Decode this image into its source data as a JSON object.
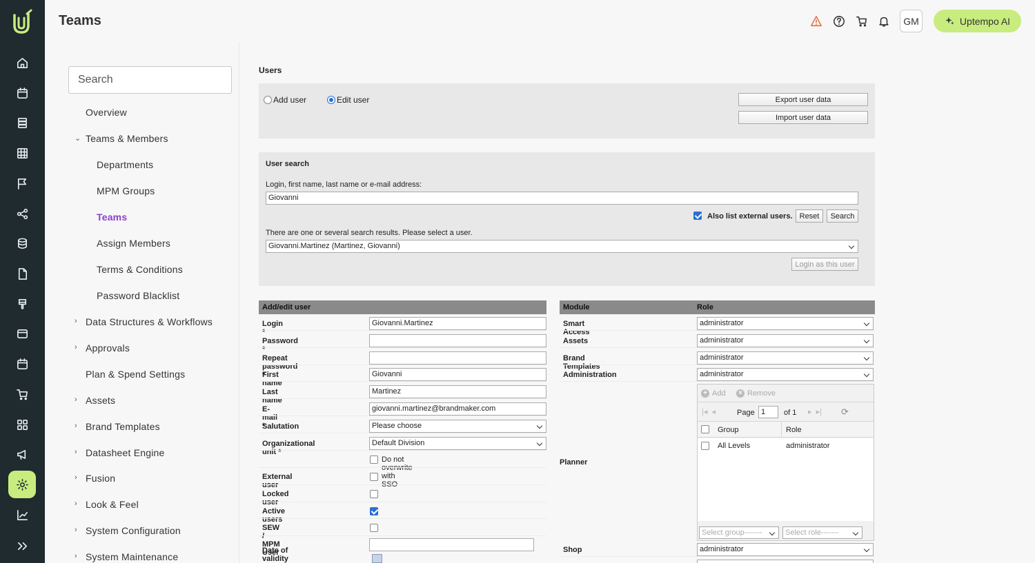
{
  "app": {
    "title": "Teams"
  },
  "header": {
    "avatar_initials": "GM",
    "ai_button_label": "Uptempo AI"
  },
  "rail_icons": [
    "home-icon",
    "calendar-icon",
    "stack-icon",
    "grid-table-icon",
    "flag-icon",
    "share-nodes-icon",
    "database-icon",
    "document-icon",
    "brush-icon",
    "window-icon",
    "calendar-icon",
    "cart-icon",
    "apps-icon",
    "megaphone-icon",
    "settings-icon",
    "chart-icon",
    "expand-icon"
  ],
  "sidebar": {
    "search_placeholder": "Search",
    "items": [
      {
        "label": "Overview"
      },
      {
        "label": "Teams & Members"
      },
      {
        "label": "Departments"
      },
      {
        "label": "MPM Groups"
      },
      {
        "label": "Teams"
      },
      {
        "label": "Assign Members"
      },
      {
        "label": "Terms & Conditions"
      },
      {
        "label": "Password Blacklist"
      },
      {
        "label": "Data Structures & Workflows"
      },
      {
        "label": "Approvals"
      },
      {
        "label": "Plan & Spend Settings"
      },
      {
        "label": "Assets"
      },
      {
        "label": "Brand Templates"
      },
      {
        "label": "Datasheet Engine"
      },
      {
        "label": "Fusion"
      },
      {
        "label": "Look & Feel"
      },
      {
        "label": "System Configuration"
      },
      {
        "label": "System Maintenance"
      }
    ]
  },
  "users": {
    "title": "Users",
    "add_user": "Add user",
    "edit_user": "Edit user",
    "export_label": "Export user data",
    "import_label": "Import user data"
  },
  "user_search": {
    "title": "User search",
    "query_label": "Login, first name, last name or e-mail address:",
    "query_value": "Giovanni",
    "external_label": "Also list external users.",
    "reset_label": "Reset",
    "search_label": "Search",
    "results_label": "There are one or several search results. Please select a user.",
    "selected_user": "Giovanni.Martinez (Martinez, Giovanni)",
    "login_as_label": "Login as this user"
  },
  "edit_user": {
    "header": "Add/edit user",
    "login_label": "Login",
    "login_value": "Giovanni.Martinez",
    "password_label": "Password",
    "repeat_password_label": "Repeat password",
    "first_name_label": "First name",
    "first_name_value": "Giovanni",
    "last_name_label": "Last name",
    "last_name_value": "Martinez",
    "email_label": "E-mail",
    "email_value": "giovanni.martinez@brandmaker.com",
    "salutation_label": "Salutation",
    "salutation_value": "Please choose",
    "org_unit_label": "Organizational unit",
    "org_unit_value": "Default Division",
    "sso_label": "Do not overwrite with SSO",
    "external_label": "External user",
    "locked_label": "Locked user",
    "active_label": "Active users",
    "sew_label": "SEW / MPM User",
    "validity_label": "Date of validity",
    "required_mark": "*"
  },
  "modules": {
    "module_header": "Module",
    "role_header": "Role",
    "rows": [
      {
        "module": "Smart Access",
        "role": "administrator"
      },
      {
        "module": "Assets",
        "role": "administrator"
      },
      {
        "module": "Brand Templates",
        "role": "administrator"
      },
      {
        "module": "Administration",
        "role": "administrator"
      }
    ],
    "planner_label": "Planner",
    "planner_grid": {
      "add_label": "Add",
      "remove_label": "Remove",
      "page_label": "Page",
      "page_value": "1",
      "of_label": "of 1",
      "col_group": "Group",
      "col_role": "Role",
      "row_group": "All Levels",
      "row_role": "administrator",
      "select_group": "Select group-------",
      "select_role": "Select role-------"
    },
    "shop_label": "Shop",
    "shop_role": "administrator"
  }
}
